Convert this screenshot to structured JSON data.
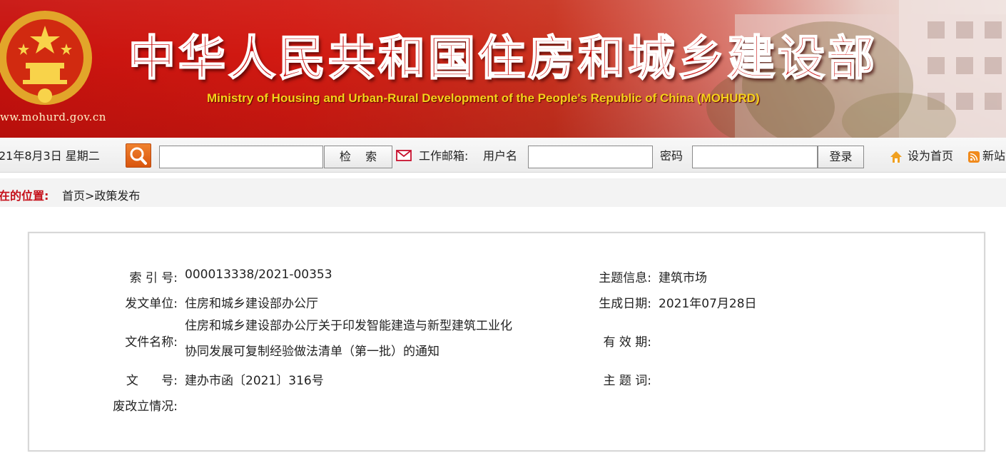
{
  "banner": {
    "site_url": "ww.mohurd.gov.cn",
    "title": "中华人民共和国住房和城乡建设部",
    "subtitle": "Ministry of Housing and Urban-Rural Development of the People's Republic of China (MOHURD)",
    "emblem_icon": "national-emblem-icon",
    "colors": {
      "red": "#c8120e",
      "gold": "#f4d21a"
    }
  },
  "toolbar": {
    "date": "21年8月3日 星期二",
    "search_button_label": "检    索",
    "email_label": "工作邮箱:",
    "username_label": "用户名",
    "password_label": "密码",
    "login_button_label": "登录",
    "set_home_label": "设为首页",
    "rss_label": "新站"
  },
  "breadcrumb": {
    "label": "在的位置:",
    "path": "首页>政策发布"
  },
  "info": {
    "index_label": "索 引 号:",
    "index_value": "000013338/2021-00353",
    "topic_label": "主题信息:",
    "topic_value": "建筑市场",
    "issuer_label": "发文单位:",
    "issuer_value": "住房和城乡建设部办公厅",
    "date_label": "生成日期:",
    "date_value": "2021年07月28日",
    "filename_label": "文件名称:",
    "filename_value": "住房和城乡建设部办公厅关于印发智能建造与新型建筑工业化协同发展可复制经验做法清单（第一批）的通知",
    "validity_label": "有 效 期:",
    "validity_value": "",
    "docno_label": "文      号:",
    "docno_value": "建办市函〔2021〕316号",
    "keywords_label": "主 题 词:",
    "keywords_value": "",
    "status_label": "废改立情况:",
    "status_value": ""
  }
}
